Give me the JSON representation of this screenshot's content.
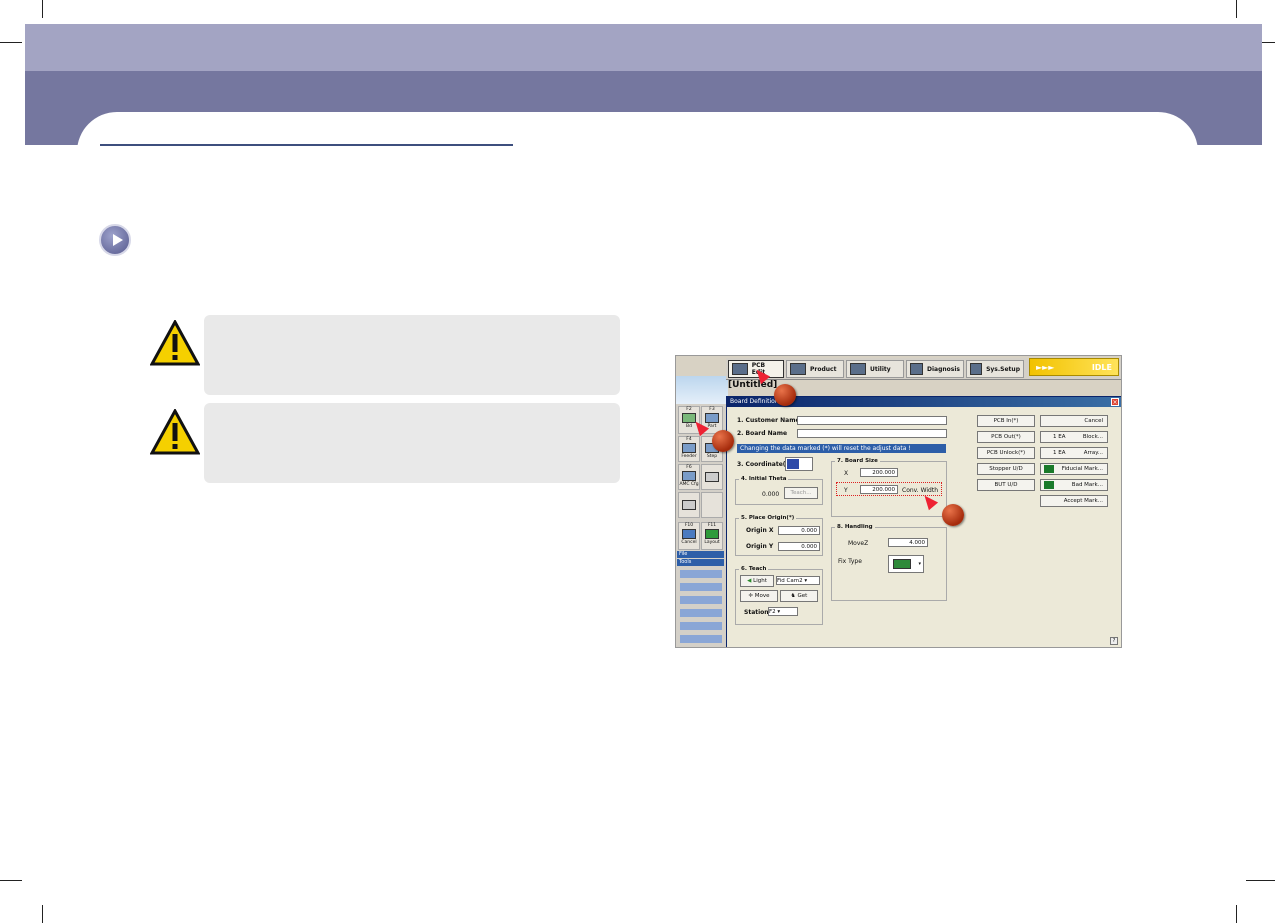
{
  "screenshot": {
    "topbar": {
      "pcb_edit": "PCB Edit",
      "product": "Product",
      "utility": "Utility",
      "diagnosis": "Diagnosis",
      "sys_setup": "Sys.Setup",
      "status_arrows": "►►►",
      "status": "IDLE"
    },
    "window_title": "[Untitled]",
    "left_panel": {
      "f2": "F2",
      "f2_label": "Bd",
      "f3": "F3",
      "f3_label": "Part",
      "f4": "F4",
      "f4_label": "Feeder",
      "step": "Step",
      "f6": "F6",
      "f6_label": "AMC Cfg",
      "f10": "F10",
      "f10_label": "Cancel",
      "f11": "F11",
      "f11_label": "Layout",
      "file": "File",
      "tools": "Tools"
    },
    "dialog": {
      "title": "Board Definition",
      "customer_name_label": "1. Customer Name",
      "board_name_label": "2. Board Name",
      "warning": "Changing the data marked (*) will reset the adjust data !",
      "coordinate_label": "3. Coordinate(*)",
      "initial_theta_label": "4. Initial Theta",
      "initial_theta_value": "0.000",
      "teach_button": "Teach...",
      "place_origin_label": "5. Place Origin(*)",
      "origin_x_label": "Origin X",
      "origin_x_value": "0.000",
      "origin_y_label": "Origin Y",
      "origin_y_value": "0.000",
      "teach_group_label": "6. Teach",
      "light_button": "Light",
      "camera_select": "Fid Cam2",
      "move_button": "Move",
      "get_button": "Get",
      "station_label": "Station",
      "station_value": "F2",
      "board_size_label": "7. Board Size",
      "x_label": "X",
      "x_value": "200.000",
      "y_label": "Y",
      "y_value": "200.000",
      "conv_width": "Conv. Width",
      "handling_label": "8. Handling",
      "movez_label": "MoveZ",
      "movez_value": "4.000",
      "fix_type_label": "Fix Type",
      "pcb_in": "PCB In(*)",
      "pcb_out": "PCB Out(*)",
      "pcb_unlock": "PCB Unlock(*)",
      "stopper_ud": "Stopper U/D",
      "bot_ud": "BUT U/D",
      "cancel": "Cancel",
      "block_count": "1 EA",
      "block": "Block...",
      "array_count": "1 EA",
      "array": "Array...",
      "fiducial_mark": "Fiducial Mark...",
      "bad_mark": "Bad Mark...",
      "accept_mark": "Accept Mark..."
    }
  },
  "colors": {
    "header_light": "#a3a4c3",
    "header_dark": "#75779f",
    "note_bg": "#e9e9e9",
    "marker": "#c2411a"
  }
}
